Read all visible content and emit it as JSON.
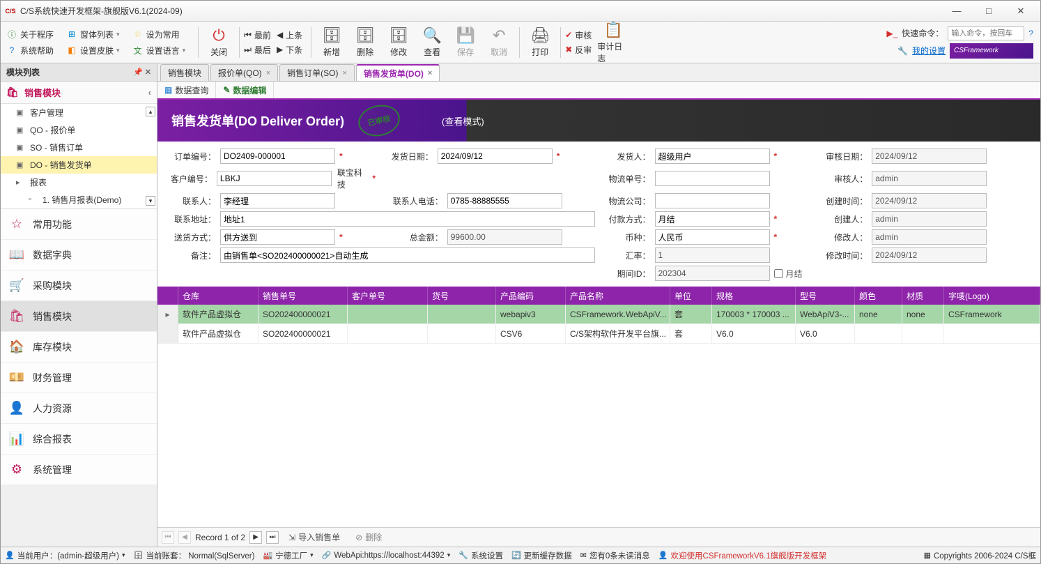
{
  "window": {
    "title": "C/S系统快速开发框架-旗舰版V6.1(2024-09)"
  },
  "menu": {
    "about": "关于程序",
    "formList": "窗体列表",
    "setCommon": "设为常用",
    "sysHelp": "系统帮助",
    "setSkin": "设置皮肤",
    "setLang": "设置语言",
    "close": "关闭",
    "first": "最前",
    "last": "最后",
    "prev": "上条",
    "next": "下条",
    "add": "新增",
    "delete": "删除",
    "modify": "修改",
    "view": "查看",
    "save": "保存",
    "cancel": "取消",
    "print": "打印",
    "approve": "审核",
    "reject": "反审",
    "auditLog": "审计日志",
    "quickCmd": "快速命令：",
    "cmdPlaceholder": "输入命令，按回车",
    "mySettings": "我的设置",
    "brand": "CSFramework"
  },
  "sidebar": {
    "title": "模块列表",
    "activeCat": "销售模块",
    "tree": [
      "客户管理",
      "QO - 报价单",
      "SO - 销售订单",
      "DO - 销售发货单",
      "报表",
      "1. 销售月报表(Demo)"
    ],
    "treeSelIndex": 3,
    "modules": [
      "常用功能",
      "数据字典",
      "采购模块",
      "销售模块",
      "库存模块",
      "财务管理",
      "人力资源",
      "综合报表",
      "系统管理"
    ],
    "modSelIndex": 3
  },
  "tabs": [
    {
      "label": "销售模块",
      "closable": false
    },
    {
      "label": "报价单(QO)",
      "closable": true
    },
    {
      "label": "销售订单(SO)",
      "closable": true
    },
    {
      "label": "销售发货单(DO)",
      "closable": true,
      "active": true
    }
  ],
  "subtabs": {
    "query": "数据查询",
    "edit": "数据编辑"
  },
  "doc": {
    "title": "销售发货单(DO Deliver Order)",
    "stamp": "已审核",
    "mode": "(查看模式)"
  },
  "form": {
    "orderNo": {
      "label": "订单编号：",
      "value": "DO2409-000001"
    },
    "deliverDate": {
      "label": "发货日期：",
      "value": "2024/09/12"
    },
    "deliverer": {
      "label": "发货人：",
      "value": "超级用户"
    },
    "approveDate": {
      "label": "审核日期：",
      "value": "2024/09/12"
    },
    "custCode": {
      "label": "客户编号：",
      "value": "LBKJ",
      "name": "联宝科技"
    },
    "logisticsNo": {
      "label": "物流单号：",
      "value": ""
    },
    "approver": {
      "label": "审核人：",
      "value": "admin"
    },
    "contact": {
      "label": "联系人：",
      "value": "李经理"
    },
    "contactTel": {
      "label": "联系人电话：",
      "value": "0785-88885555"
    },
    "logisticsCo": {
      "label": "物流公司：",
      "value": ""
    },
    "createTime": {
      "label": "创建时间：",
      "value": "2024/09/12"
    },
    "contactAddr": {
      "label": "联系地址：",
      "value": "地址1"
    },
    "payMethod": {
      "label": "付款方式：",
      "value": "月结"
    },
    "creator": {
      "label": "创建人：",
      "value": "admin"
    },
    "shipMethod": {
      "label": "送货方式：",
      "value": "供方送到"
    },
    "totalAmt": {
      "label": "总金额：",
      "value": "99600.00"
    },
    "currency": {
      "label": "币种：",
      "value": "人民币"
    },
    "modifier": {
      "label": "修改人：",
      "value": "admin"
    },
    "remark": {
      "label": "备注：",
      "value": "由销售单<SO202400000021>自动生成"
    },
    "rate": {
      "label": "汇率：",
      "value": "1"
    },
    "modifyTime": {
      "label": "修改时间：",
      "value": "2024/09/12"
    },
    "periodId": {
      "label": "期间ID：",
      "value": "202304"
    },
    "monthClose": "月结"
  },
  "grid": {
    "cols": [
      "仓库",
      "销售单号",
      "客户单号",
      "货号",
      "产品编码",
      "产品名称",
      "单位",
      "规格",
      "型号",
      "颜色",
      "材质",
      "字唛(Logo)"
    ],
    "rows": [
      {
        "wh": "软件产品虚拟仓",
        "so": "SO202400000021",
        "cn": "",
        "pn": "",
        "pc": "webapiv3",
        "nm": "CSFramework.WebApiV...",
        "un": "套",
        "sp": "170003 * 170003 ...",
        "md": "WebApiV3-...",
        "cl": "none",
        "mt": "none",
        "lg": "CSFramework",
        "sel": true
      },
      {
        "wh": "软件产品虚拟仓",
        "so": "SO202400000021",
        "cn": "",
        "pn": "",
        "pc": "CSV6",
        "nm": "C/S架构软件开发平台旗...",
        "un": "套",
        "sp": "V6.0",
        "md": "V6.0",
        "cl": "",
        "mt": "",
        "lg": ""
      }
    ],
    "recordText": "Record 1 of 2",
    "importBtn": "导入销售单",
    "deleteBtn": "删除"
  },
  "status": {
    "user": "当前用户：(admin-超级用户)",
    "account": "当前账套： Normal(SqlServer)",
    "factory": "宁德工厂",
    "api": "WebApi:https://localhost:44392",
    "sysSetting": "系统设置",
    "refreshCache": "更新缓存数据",
    "msg": "您有0条未读消息",
    "welcome": "欢迎使用CSFrameworkV6.1旗舰版开发框架",
    "copyright": "Copyrights 2006-2024 C/S框"
  }
}
